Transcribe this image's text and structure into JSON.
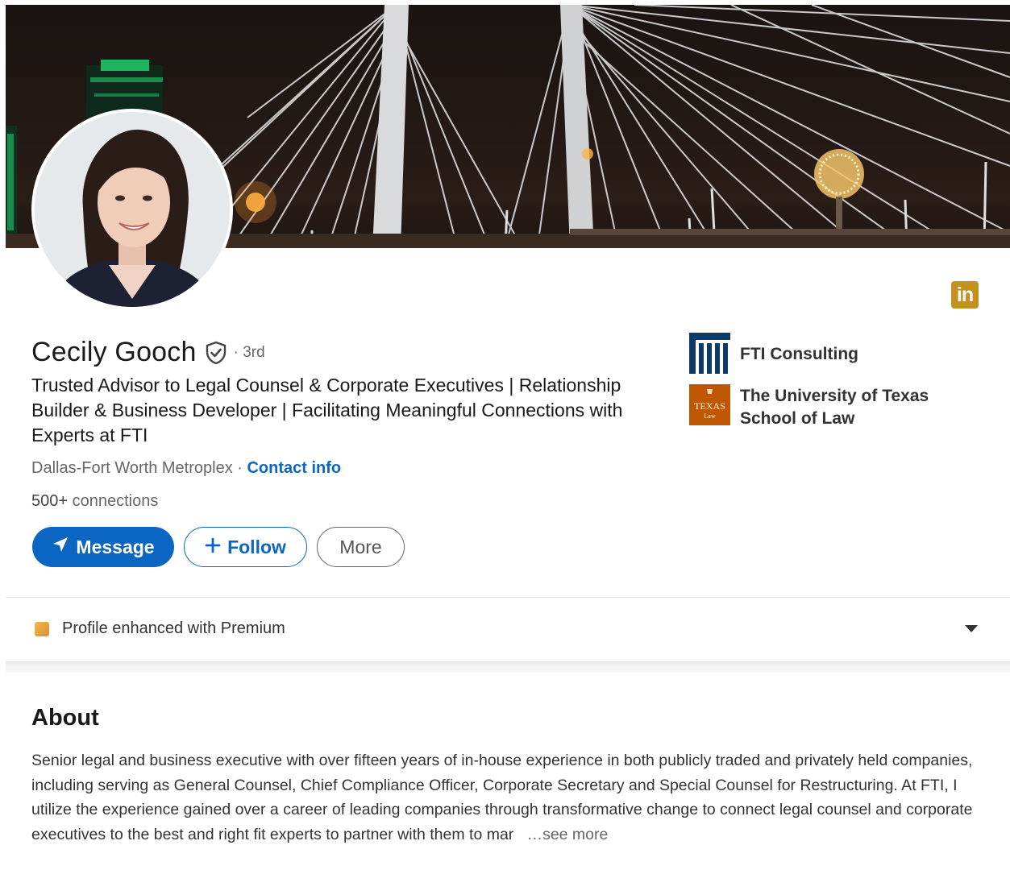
{
  "profile": {
    "name": "Cecily Gooch",
    "degree": "· 3rd",
    "headline": "Trusted Advisor to Legal Counsel & Corporate Executives | Relationship Builder & Business Developer | Facilitating Meaningful Connections with Experts at FTI",
    "location": "Dallas-Fort Worth Metroplex ·",
    "contact_info": "Contact info",
    "connections_count": "500+",
    "connections_label": "connections"
  },
  "actions": {
    "message": "Message",
    "follow": "Follow",
    "more": "More"
  },
  "organizations": {
    "company": "FTI Consulting",
    "school": "The University of Texas School of Law",
    "school_logo_text_1": "TEXAS",
    "school_logo_text_2": "Law"
  },
  "premium": {
    "label": "Profile enhanced with Premium"
  },
  "about": {
    "title": "About",
    "body": "Senior legal and business executive with over fifteen years of in-house experience in both publicly traded and privately held companies, including serving as General Counsel, Chief Compliance Officer, Corporate Secretary and Special Counsel for Restructuring. At FTI, I utilize the experience gained over a career of leading companies through transformative change to connect legal counsel and corporate executives to the best and right fit experts to partner with them to mar",
    "see_more": "…see more"
  },
  "badge": {
    "linkedin_text": "in"
  },
  "colors": {
    "link_blue": "#0a66c2",
    "premium_gold": "#c4911f",
    "ut_orange": "#bf5700",
    "fti_navy": "#0b3a6b"
  }
}
